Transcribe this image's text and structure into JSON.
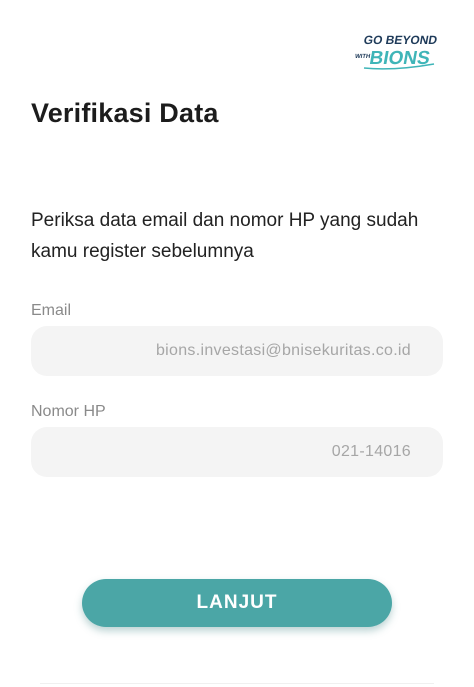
{
  "logo": {
    "line1": "GO BEYOND",
    "line2_small": "WITH",
    "line2_big": "BIONS"
  },
  "title": "Verifikasi Data",
  "description": "Periksa data email dan nomor HP yang sudah kamu register sebelumnya",
  "fields": {
    "email": {
      "label": "Email",
      "value": "bions.investasi@bnisekuritas.co.id"
    },
    "phone": {
      "label": "Nomor HP",
      "value": "021-14016"
    }
  },
  "submit_label": "LANJUT",
  "colors": {
    "accent": "#4ba6a6",
    "field_background": "#f4f4f4",
    "logo_text": "#1f3b5a",
    "logo_brand": "#3fb5b8"
  }
}
